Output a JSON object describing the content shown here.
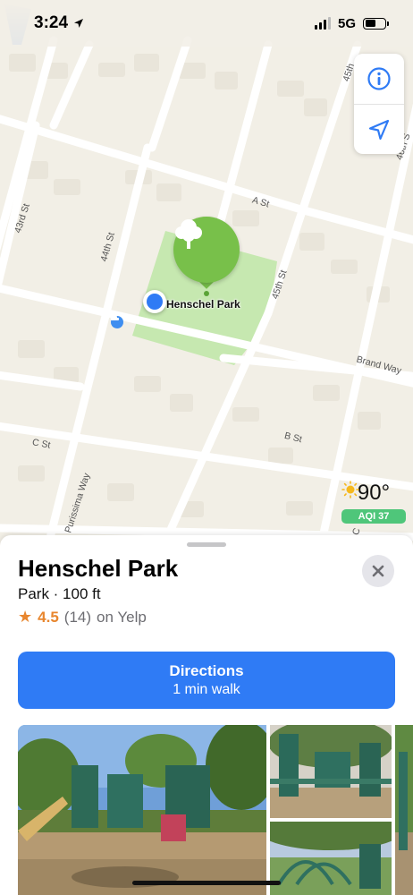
{
  "status_bar": {
    "time": "3:24",
    "network": "5G"
  },
  "map": {
    "info_icon": "info-icon",
    "location_icon": "location-arrow-icon",
    "park_label": "Henschel Park",
    "streets": {
      "s1": "43rd St",
      "s2": "44th St",
      "s3": "45th St",
      "s4": "45th",
      "s5": "46th S",
      "s6": "A St",
      "s7": "B St",
      "s8": "C St",
      "s9": "Brand Way",
      "s10": "Purissima Way",
      "s11": "C"
    },
    "weather": {
      "temperature": "90°",
      "aqi": "AQI 37"
    }
  },
  "place": {
    "title": "Henschel Park",
    "subtitle": "Park · 100 ft",
    "rating_score": "4.5",
    "rating_count": "(14)",
    "rating_source": "on Yelp"
  },
  "directions": {
    "title": "Directions",
    "subtitle": "1 min walk"
  },
  "colors": {
    "accent": "#2f7bf5",
    "park_pin": "#78c04a",
    "rating_star": "#e8862e",
    "aqi_badge": "#4fc67a"
  }
}
